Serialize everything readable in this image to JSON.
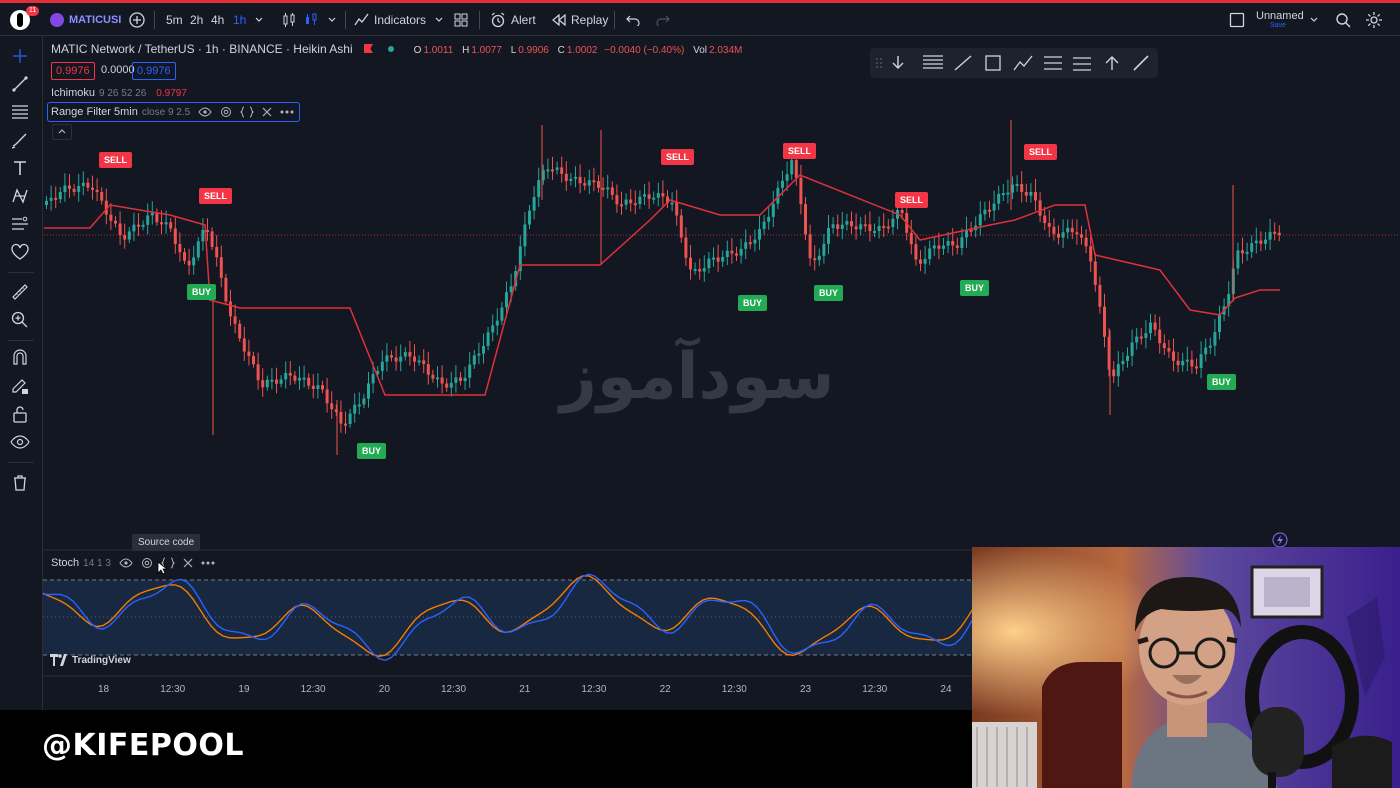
{
  "topbar": {
    "notif_count": "11",
    "symbol": "MATICUSI",
    "intervals": [
      "5m",
      "2h",
      "4h",
      "1h"
    ],
    "active_interval": "1h",
    "indicators_label": "Indicators",
    "alert_label": "Alert",
    "replay_label": "Replay",
    "layout_name": "Unnamed",
    "layout_sub": "Save"
  },
  "legend": {
    "title": "MATIC Network / TetherUS · 1h · BINANCE · Heikin Ashi",
    "o_label": "O",
    "o_val": "1.0011",
    "h_label": "H",
    "h_val": "1.0077",
    "l_label": "L",
    "l_val": "0.9906",
    "c_label": "C",
    "c_val": "1.0002",
    "change": "−0.0040 (−0.40%)",
    "vol_label": "Vol",
    "vol_val": "2.034M",
    "bid": "0.9976",
    "spread": "0.0000",
    "ask": "0.9976"
  },
  "indicators": {
    "ichimoku_name": "Ichimoku",
    "ichimoku_params": "9 26 52 26",
    "ichimoku_val": "0.9797",
    "range_filter_name": "Range Filter 5min",
    "range_filter_params": "close 9 2.5",
    "stoch_name": "Stoch",
    "stoch_params": "14 1 3"
  },
  "tooltip": "Source code",
  "signals": {
    "sell": "SELL",
    "buy": "BUY"
  },
  "watermark": "سودآموز",
  "tradingview_brand": "TradingView",
  "time_axis": [
    "18",
    "12:30",
    "19",
    "12:30",
    "20",
    "12:30",
    "21",
    "12:30",
    "22",
    "12:30",
    "23",
    "12:30",
    "24"
  ],
  "handle": "@KIFEPOOL",
  "colors": {
    "bg": "#131722",
    "up": "#26a69a",
    "down": "#ef5350",
    "range_filter": "#e0303a",
    "stoch_k": "#2962ff",
    "stoch_d": "#f57c00",
    "sell": "#f23645",
    "buy": "#22ab54"
  }
}
